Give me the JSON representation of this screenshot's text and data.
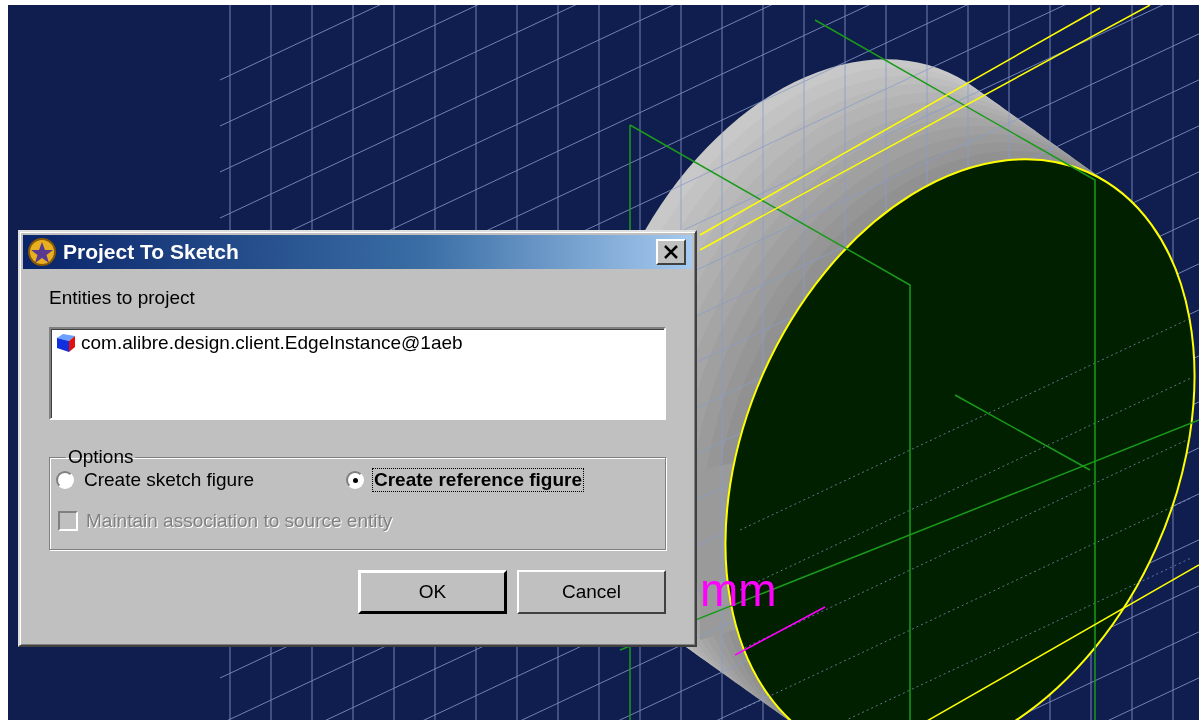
{
  "viewport": {
    "dimension_text": "mm"
  },
  "dialog": {
    "title": "Project To Sketch",
    "entities_label": "Entities to project",
    "entities": [
      {
        "text": "com.alibre.design.client.EdgeInstance@1aeb"
      }
    ],
    "options": {
      "legend": "Options",
      "radios": [
        {
          "label": "Create sketch figure",
          "selected": false
        },
        {
          "label": "Create reference figure",
          "selected": true
        }
      ],
      "checkbox": {
        "label": "Maintain association to source entity",
        "checked": false,
        "disabled": true
      }
    },
    "buttons": [
      {
        "label": "OK",
        "default": true
      },
      {
        "label": "Cancel",
        "default": false
      }
    ]
  }
}
